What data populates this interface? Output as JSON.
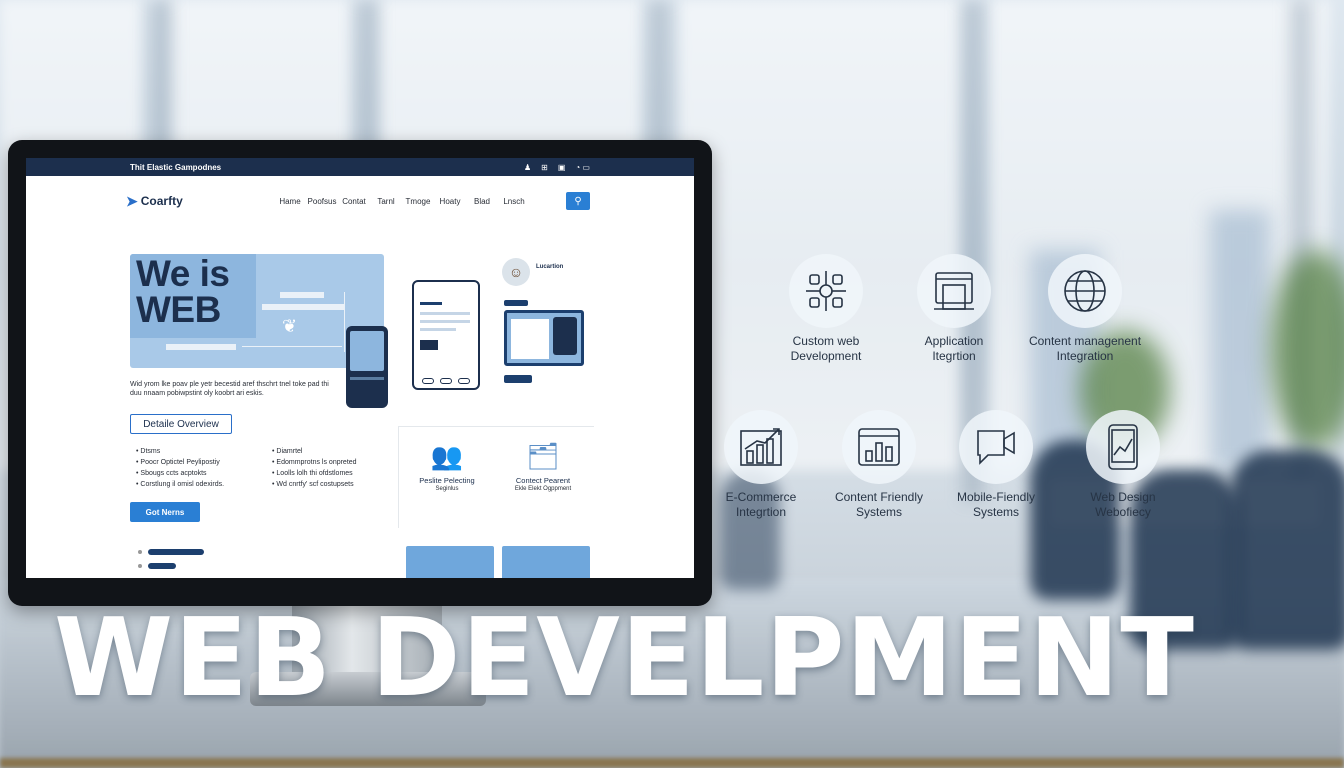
{
  "screen": {
    "topbar": {
      "title": "Thit Elastic Gampodnes"
    },
    "logo": {
      "name": "Coarfty"
    },
    "menu": [
      "Hame",
      "Poofsus",
      "Contat",
      "Tarnl",
      "Tmoge",
      "Hoaty",
      "Blad",
      "Lnsch"
    ],
    "hero": {
      "title_line1": "We is",
      "title_line2": "WEB",
      "text": "Wid yrom lke poav ple yetr becestid aref thschrt tnel toke pad thi duu nnaam pobiwpstint oly koobrt ari eskis."
    },
    "overview_button": "Detaile Overview",
    "list_left": [
      "Dtsms",
      "Poocr Optictel Peylipostiy",
      "Sbougs ccts acptokts",
      "Corstlung il omisl odexirds."
    ],
    "list_right": [
      "Diamrtel",
      "Edommprotns ls onpreted",
      "Loolls lolh thi ofdstlomes",
      "Wd cnrtfy' scf costupsets"
    ],
    "go_button": "Got Nerns",
    "profile": {
      "name": "Lucartion"
    },
    "features": [
      {
        "title": "Peslite Pelecting",
        "sub": "Seginlus"
      },
      {
        "title": "Contect Pearent",
        "sub": "Ekle Elekt Ogppment"
      }
    ]
  },
  "services": [
    {
      "label_1": "Custom web",
      "label_2": "Development",
      "icon": "network-hub-icon"
    },
    {
      "label_1": "Application",
      "label_2": "Itegrtion",
      "icon": "app-window-icon"
    },
    {
      "label_1": "Content managenent",
      "label_2": "Integration",
      "icon": "globe-icon"
    },
    {
      "label_1": "E-Commerce",
      "label_2": "Integrtion",
      "icon": "growth-chart-icon"
    },
    {
      "label_1": "Content Friendly",
      "label_2": "Systems",
      "icon": "browser-bars-icon"
    },
    {
      "label_1": "Mobile-Fiendly",
      "label_2": "Systems",
      "icon": "chat-camera-icon"
    },
    {
      "label_1": "Web Design",
      "label_2": "Webofiecy",
      "icon": "tablet-chart-icon"
    }
  ],
  "headline": "WEB DEVELPMENT",
  "colors": {
    "navy": "#1c2f4d",
    "accent": "#2a7fd4",
    "hero": "#a9c9e8"
  }
}
